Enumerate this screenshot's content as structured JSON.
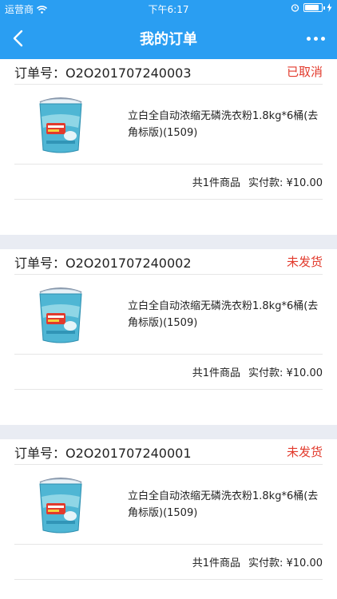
{
  "status_bar": {
    "carrier": "运营商",
    "time": "下午6:17"
  },
  "navbar": {
    "title": "我的订单"
  },
  "orders": [
    {
      "order_no": "订单号：O2O201707240003",
      "status": "已取消",
      "product_name": "立白全自动浓缩无磷洗衣粉1.8kg*6桶(去角标版)(1509)",
      "count_text": "共1件商品",
      "amount_text": "实付款: ¥10.00"
    },
    {
      "order_no": "订单号：O2O201707240002",
      "status": "未发货",
      "product_name": "立白全自动浓缩无磷洗衣粉1.8kg*6桶(去角标版)(1509)",
      "count_text": "共1件商品",
      "amount_text": "实付款: ¥10.00"
    },
    {
      "order_no": "订单号：O2O201707240001",
      "status": "未发货",
      "product_name": "立白全自动浓缩无磷洗衣粉1.8kg*6桶(去角标版)(1509)",
      "count_text": "共1件商品",
      "amount_text": "实付款: ¥10.00"
    }
  ],
  "colors": {
    "header": "#2a9ef2",
    "status_red": "#e23a2c",
    "page_bg": "#e9ecf3"
  }
}
